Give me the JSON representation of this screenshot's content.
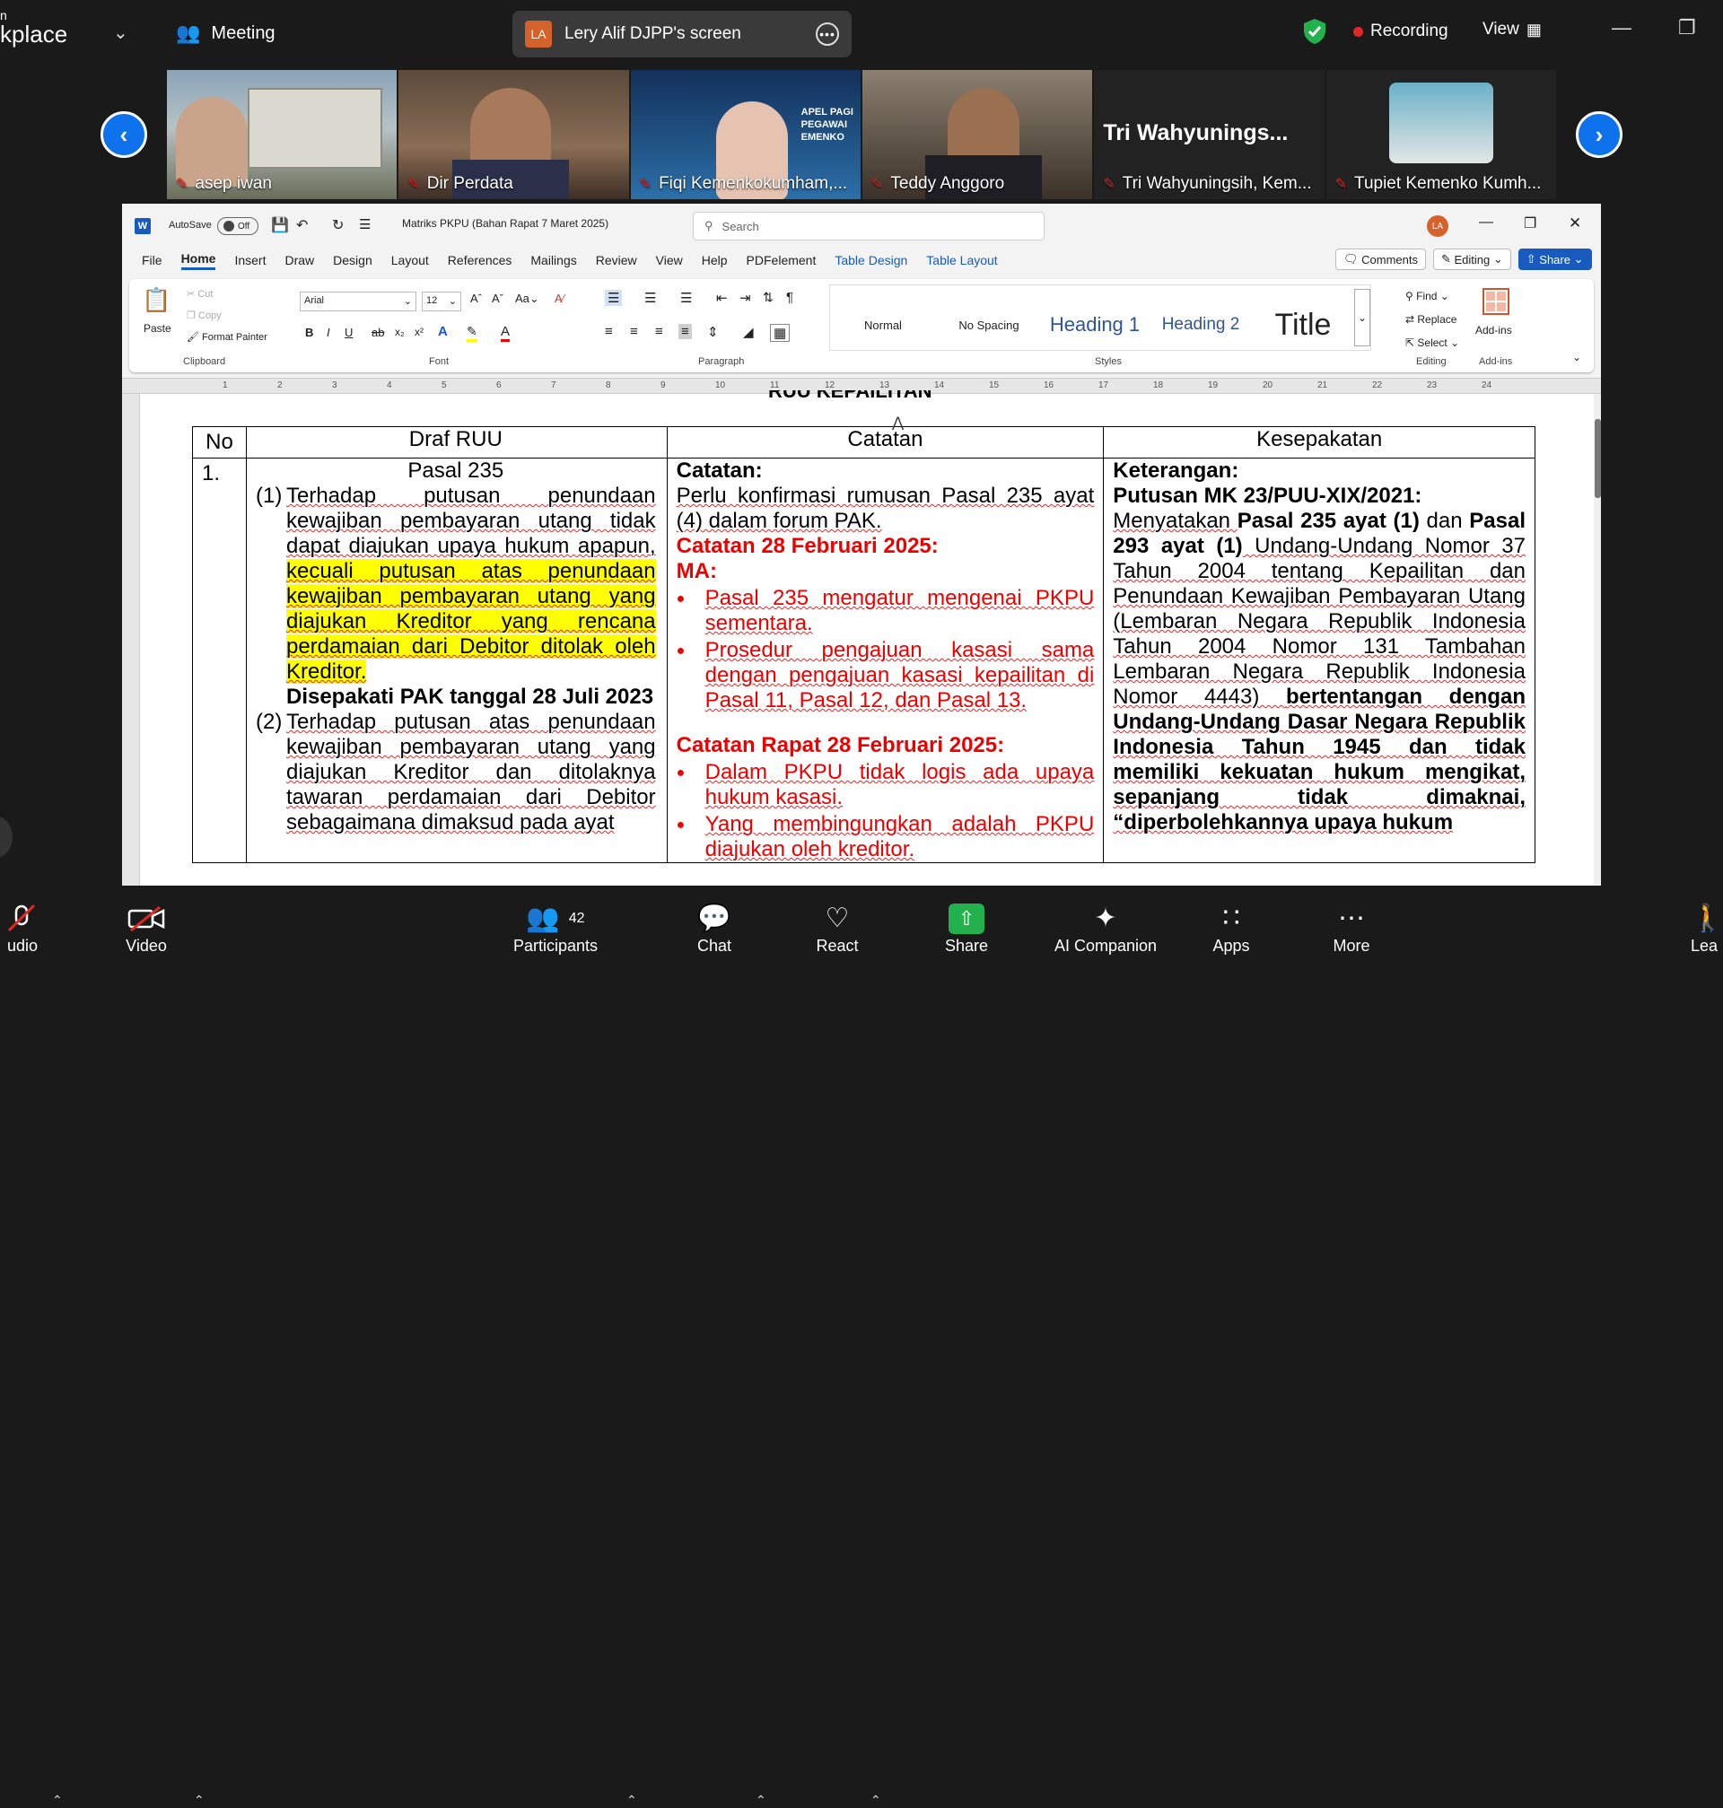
{
  "zoom_bar": {
    "brand": "kplace",
    "meeting_label": "Meeting",
    "screen_share_label": "Lery Alif DJPP's screen",
    "screen_share_badge": "LA",
    "recording_label": "Recording",
    "view_label": "View"
  },
  "participants_strip": [
    {
      "name": "asep iwan"
    },
    {
      "name": "Dir Perdata"
    },
    {
      "name": "Fiqi Kemenkokumham,..."
    },
    {
      "name": "Teddy Anggoro"
    },
    {
      "name": "Tri Wahyuningsih, Kem...",
      "display": "Tri  Wahyunings..."
    },
    {
      "name": "Tupiet Kemenko Kumh..."
    }
  ],
  "word": {
    "autosave_label": "AutoSave",
    "autosave_state": "Off",
    "doc_title": "Matriks PKPU (Bahan Rapat 7 Maret 2025)",
    "search_placeholder": "Search",
    "user_badge": "LA",
    "tabs": [
      "File",
      "Home",
      "Insert",
      "Draw",
      "Design",
      "Layout",
      "References",
      "Mailings",
      "Review",
      "View",
      "Help",
      "PDFelement",
      "Table Design",
      "Table Layout"
    ],
    "comments_label": "Comments",
    "editing_label": "Editing",
    "share_label": "Share",
    "clipboard": {
      "paste": "Paste",
      "cut": "Cut",
      "copy": "Copy",
      "format_painter": "Format Painter",
      "group": "Clipboard"
    },
    "font": {
      "name": "Arial",
      "size": "12",
      "group": "Font"
    },
    "paragraph_group": "Paragraph",
    "styles": [
      "Normal",
      "No Spacing",
      "Heading 1",
      "Heading 2",
      "Title"
    ],
    "styles_group": "Styles",
    "editing": {
      "find": "Find",
      "replace": "Replace",
      "select": "Select",
      "group": "Editing"
    },
    "addins": {
      "label": "Add-ins",
      "group": "Add-ins"
    },
    "ruler_numbers": [
      "1",
      "2",
      "3",
      "4",
      "5",
      "6",
      "7",
      "8",
      "9",
      "10",
      "11",
      "12",
      "13",
      "14",
      "15",
      "16",
      "17",
      "18",
      "19",
      "20",
      "21",
      "22",
      "23",
      "24"
    ]
  },
  "document": {
    "cut_heading": "RUU KEPAILITAN",
    "headers": [
      "No",
      "Draf RUU",
      "Catatan",
      "Kesepakatan"
    ],
    "row_no": "1.",
    "draf": {
      "pasal": "Pasal 235",
      "p1_num": "(1)",
      "p1_plain": "Terhadap putusan penundaan kewajiban pembayaran utang tidak dapat diajukan upaya hukum apapun,",
      "p1_highlight": "kecuali putusan atas penundaan kewajiban pembayaran utang yang diajukan Kreditor yang rencana perdamaian dari Debitor ditolak oleh Kreditor.",
      "agreed": "Disepakati PAK tanggal 28 Juli 2023",
      "p2_num": "(2)",
      "p2": "Terhadap putusan atas penundaan kewajiban pembayaran utang yang diajukan Kreditor dan ditolaknya tawaran perdamaian dari Debitor sebagaimana dimaksud pada ayat"
    },
    "catatan": {
      "heading": "Catatan:",
      "line1": "Perlu konfirmasi rumusan Pasal 235 ayat (4) dalam forum PAK.",
      "heading2": "Catatan 28 Februari 2025:",
      "ma": "MA:",
      "bullets1": [
        "Pasal 235 mengatur mengenai PKPU sementara.",
        "Prosedur pengajuan kasasi sama dengan pengajuan kasasi kepailitan di Pasal 11, Pasal 12, dan Pasal 13."
      ],
      "heading3": "Catatan Rapat 28 Februari 2025:",
      "bullets2": [
        "Dalam PKPU tidak logis ada upaya hukum kasasi.",
        "Yang membingungkan adalah PKPU diajukan oleh kreditor."
      ]
    },
    "kesepakatan": {
      "heading": "Keterangan:",
      "putusan": "Putusan MK 23/PUU-XIX/2021:",
      "t1": "Menyatakan ",
      "b1": "Pasal 235 ayat (1)",
      "t2": " dan ",
      "b2": "Pasal 293 ayat (1)",
      "t3": " Undang-Undang Nomor 37 Tahun 2004 tentang Kepailitan dan Penundaan Kewajiban Pembayaran Utang (Lembaran Negara Republik Indonesia Tahun 2004 Nomor 131 Tambahan Lembaran Negara Republik Indonesia Nomor 4443) ",
      "b3": "bertentangan dengan Undang-Undang Dasar Negara Republik Indonesia Tahun 1945 dan tidak memiliki kekuatan hukum mengikat, sepanjang tidak dimaknai, “diperbolehkannya upaya hukum"
    }
  },
  "bottom_bar": {
    "audio": "udio",
    "video": "Video",
    "participants": "Participants",
    "participants_count": "42",
    "chat": "Chat",
    "react": "React",
    "share": "Share",
    "ai": "AI Companion",
    "apps": "Apps",
    "more": "More",
    "leave": "Lea"
  },
  "colors": {
    "zoom_blue": "#0e72ed",
    "word_blue": "#185abd",
    "recording_red": "#e02828",
    "share_green": "#22b14c",
    "highlight": "#ffff00",
    "doc_red": "#e00000"
  }
}
